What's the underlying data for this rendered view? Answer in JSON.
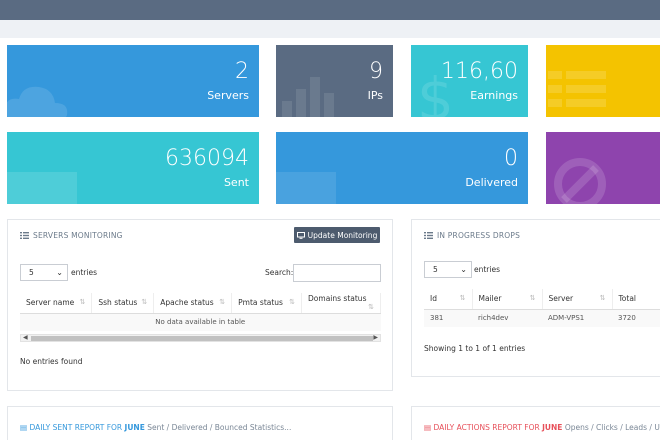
{
  "colors": {
    "blue": "#3598dc",
    "slate": "#5a6b82",
    "cyan": "#36c6d3",
    "yellow": "#f4c300",
    "purple": "#8e44ad"
  },
  "tiles": {
    "servers": {
      "value": "2",
      "label": "Servers",
      "icon": "cloud-icon"
    },
    "ips": {
      "value": "9",
      "label": "IPs",
      "icon": "bar-chart-icon"
    },
    "earnings": {
      "value": "116,60",
      "label": "Earnings",
      "icon": "dollar-icon"
    },
    "sent": {
      "value": "636094",
      "label": "Sent",
      "icon": "paper-icon"
    },
    "delivered": {
      "value": "0",
      "label": "Delivered",
      "icon": "inbox-icon"
    },
    "yellow_icon": "list-icon",
    "purple_icon": "ban-icon"
  },
  "servers_monitoring": {
    "title": "SERVERS MONITORING",
    "update_button": "Update Monitoring",
    "length_value": "5",
    "entries_label": "entries",
    "search_label": "Search:",
    "columns": [
      "Server name",
      "Ssh status",
      "Apache status",
      "Pmta status",
      "Domains status"
    ],
    "empty_message": "No data available in table",
    "footer": "No entries found"
  },
  "in_progress_drops": {
    "title": "IN PROGRESS DROPS",
    "length_value": "5",
    "entries_label": "entries",
    "columns": [
      "Id",
      "Mailer",
      "Server",
      "Total"
    ],
    "rows": [
      {
        "id": "381",
        "mailer": "rich4dev",
        "server": "ADM-VPS1",
        "total": "3720"
      }
    ],
    "footer": "Showing 1 to 1 of 1 entries"
  },
  "daily_sent": {
    "prefix": "DAILY SENT REPORT FOR",
    "month": "JUNE",
    "suffix": "Sent / Delivered / Bounced Statistics..."
  },
  "daily_actions": {
    "prefix": "DAILY ACTIONS REPORT FOR",
    "month": "JUNE",
    "suffix": "Opens / Clicks / Leads / Unsubsc"
  }
}
